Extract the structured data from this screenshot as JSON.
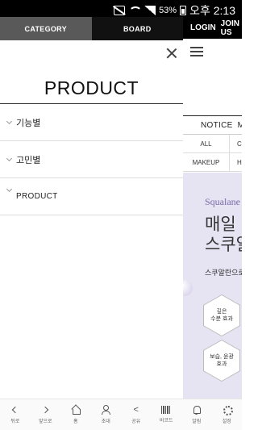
{
  "status_bar": {
    "battery_percent": "53%",
    "time": "오후 2:13"
  },
  "drawer": {
    "tabs": [
      {
        "label": "CATEGORY",
        "active": true
      },
      {
        "label": "BOARD",
        "active": false
      }
    ],
    "title": "PRODUCT",
    "menu": [
      {
        "label": "기능별"
      },
      {
        "label": "고민별"
      },
      {
        "label": "PRODUCT"
      }
    ]
  },
  "background_page": {
    "top_links": [
      "LOGIN",
      "JOIN US"
    ],
    "notice_tabs": [
      "NOTICE",
      "ME"
    ],
    "sub_rows": [
      {
        "left": "ALL",
        "right": "C"
      },
      {
        "left": "MAKEUP",
        "right": "H"
      }
    ],
    "banner": {
      "brand": "Squalane",
      "headline_line1": "매일 바",
      "headline_line2": "스쿠알",
      "description": "스쿠알란으로",
      "hex1_line1": "깊은",
      "hex1_line2": "수분 효과",
      "hex2_line1": "보습, 윤광",
      "hex2_line2": "효과"
    }
  },
  "bottom_nav": [
    {
      "label": "뒤로",
      "icon": "back-icon"
    },
    {
      "label": "앞으로",
      "icon": "forward-icon"
    },
    {
      "label": "홈",
      "icon": "home-icon"
    },
    {
      "label": "초대",
      "icon": "invite-icon"
    },
    {
      "label": "공유",
      "icon": "share-icon"
    },
    {
      "label": "바코드",
      "icon": "barcode-icon"
    },
    {
      "label": "알림",
      "icon": "bell-icon"
    },
    {
      "label": "설정",
      "icon": "gear-icon"
    }
  ]
}
